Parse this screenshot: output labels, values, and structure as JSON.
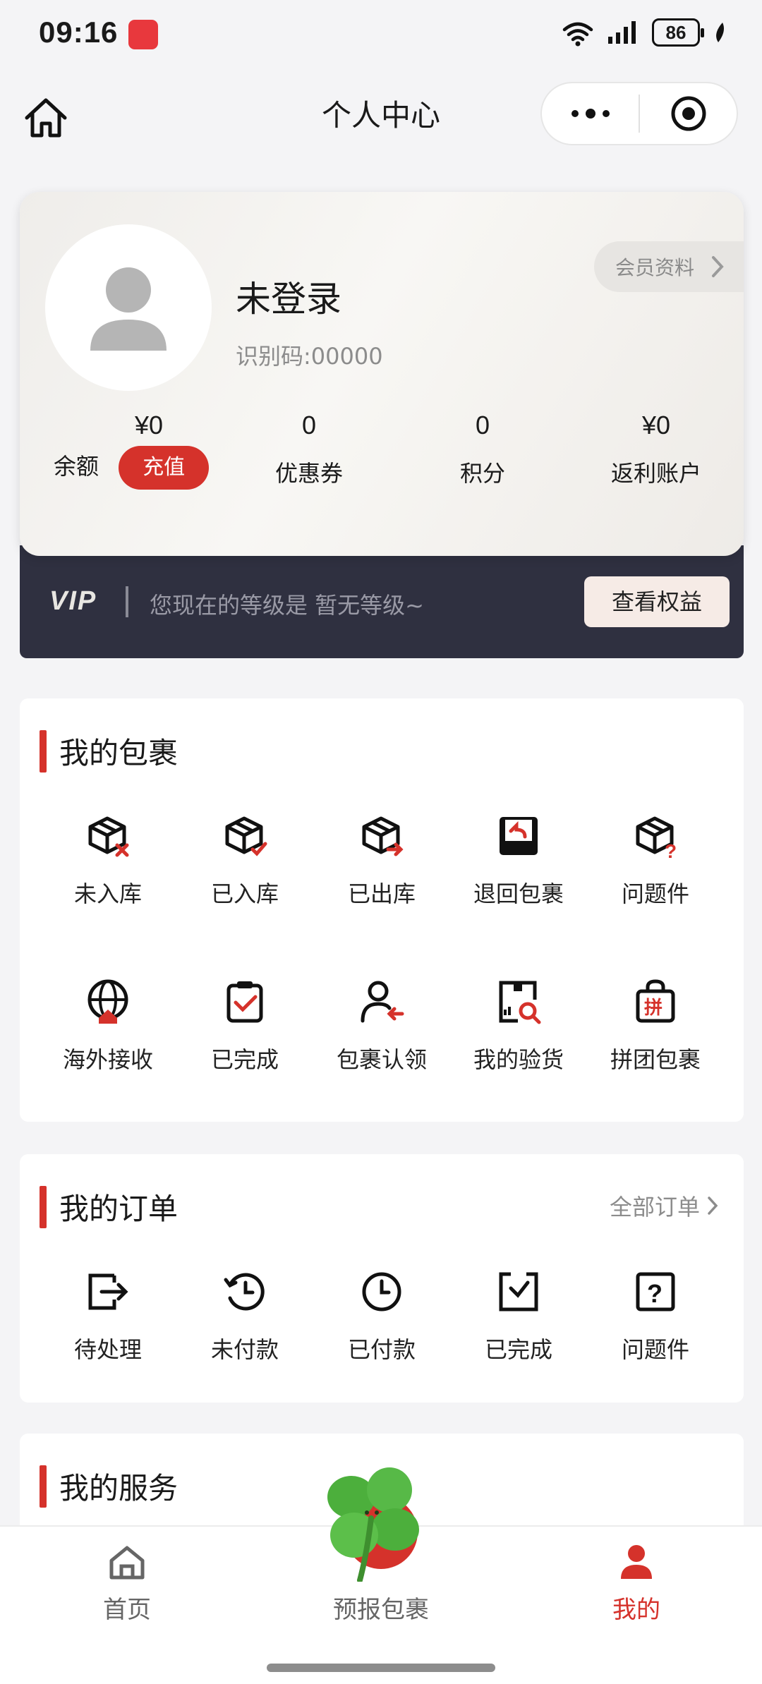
{
  "status_bar": {
    "time": "09:16",
    "battery": "86"
  },
  "nav": {
    "title": "个人中心"
  },
  "profile": {
    "username": "未登录",
    "id_code": "识别码:00000",
    "member_button": "会员资料",
    "stats": [
      {
        "value": "¥0",
        "label": "余额"
      },
      {
        "value": "0",
        "label": "优惠券"
      },
      {
        "value": "0",
        "label": "积分"
      },
      {
        "value": "¥0",
        "label": "返利账户"
      }
    ],
    "recharge_label": "充值"
  },
  "vip": {
    "logo": "VIP",
    "text": "您现在的等级是 暂无等级~",
    "button": "查看权益"
  },
  "packages": {
    "title": "我的包裹",
    "items": [
      {
        "label": "未入库",
        "icon": "box-x-icon"
      },
      {
        "label": "已入库",
        "icon": "box-check-icon"
      },
      {
        "label": "已出库",
        "icon": "box-out-icon"
      },
      {
        "label": "退回包裹",
        "icon": "return-tray-icon"
      },
      {
        "label": "问题件",
        "icon": "box-question-icon"
      },
      {
        "label": "海外接收",
        "icon": "globe-home-icon"
      },
      {
        "label": "已完成",
        "icon": "clipboard-check-icon"
      },
      {
        "label": "包裹认领",
        "icon": "user-claim-icon"
      },
      {
        "label": "我的验货",
        "icon": "inspect-icon"
      },
      {
        "label": "拼团包裹",
        "icon": "group-bag-icon"
      }
    ]
  },
  "orders": {
    "title": "我的订单",
    "more": "全部订单",
    "items": [
      {
        "label": "待处理",
        "icon": "pending-exit-icon"
      },
      {
        "label": "未付款",
        "icon": "history-clock-icon"
      },
      {
        "label": "已付款",
        "icon": "clock-icon"
      },
      {
        "label": "已完成",
        "icon": "check-square-icon"
      },
      {
        "label": "问题件",
        "icon": "question-square-icon"
      }
    ]
  },
  "services": {
    "title": "我的服务"
  },
  "tabbar": [
    {
      "label": "首页",
      "icon": "home-icon"
    },
    {
      "label": "预报包裹",
      "icon": "clover-icon"
    },
    {
      "label": "我的",
      "icon": "user-icon"
    }
  ],
  "colors": {
    "accent": "#d5322b",
    "vip_bg": "#2f3040"
  }
}
